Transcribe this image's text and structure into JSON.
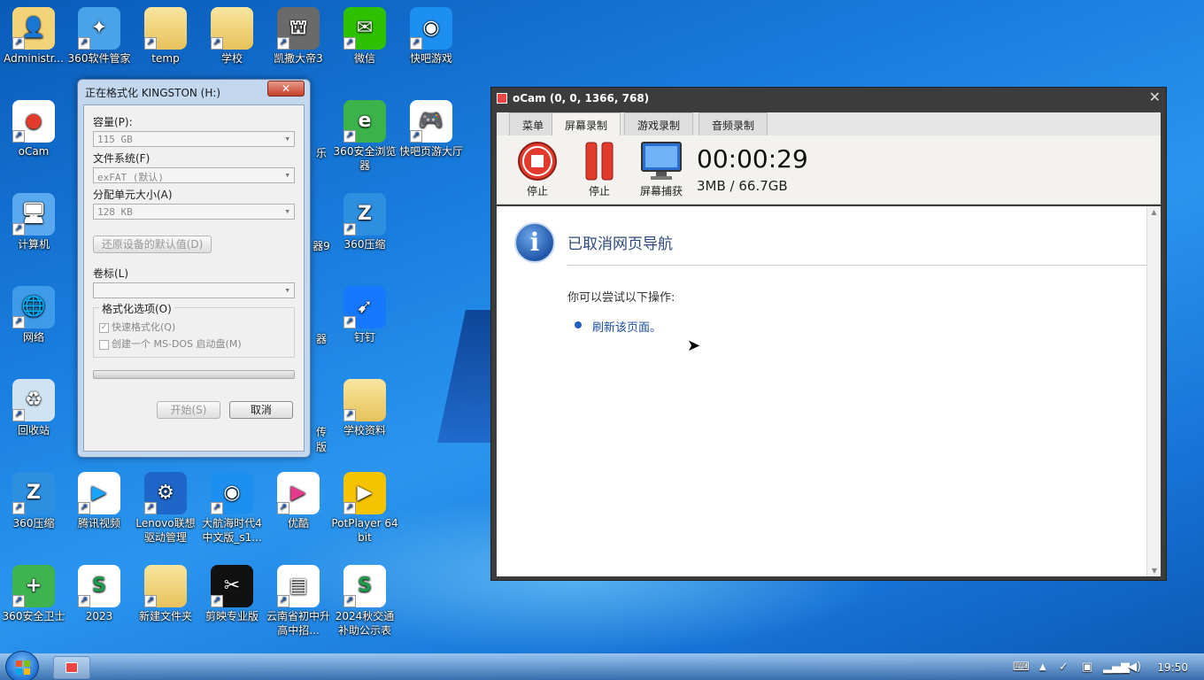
{
  "desktop": {
    "icons": [
      {
        "label": "Administr...",
        "kind": "user"
      },
      {
        "label": "360软件管家",
        "kind": "360box"
      },
      {
        "label": "temp",
        "kind": "folder"
      },
      {
        "label": "学校",
        "kind": "folder"
      },
      {
        "label": "凯撒大帝3",
        "kind": "game"
      },
      {
        "label": "微信",
        "kind": "wechat"
      },
      {
        "label": "快吧游戏",
        "kind": "kuaiba"
      },
      {
        "label": "oCam",
        "kind": "ocam"
      },
      {
        "label": "计算机",
        "kind": "computer"
      },
      {
        "label": "网络",
        "kind": "network"
      },
      {
        "label": "回收站",
        "kind": "recycle"
      },
      {
        "label": "360安全浏览器",
        "kind": "browser360"
      },
      {
        "label": "快吧页游大厅",
        "kind": "gamepad"
      },
      {
        "label": "360压缩",
        "kind": "zip360"
      },
      {
        "label": "钉钉",
        "kind": "dingtalk"
      },
      {
        "label": "学校资料",
        "kind": "folder"
      },
      {
        "label": "乐",
        "kind": "partial"
      },
      {
        "label": "器9",
        "kind": "partial"
      },
      {
        "label": "器",
        "kind": "partial"
      },
      {
        "label": "传",
        "kind": "partial"
      },
      {
        "label": "版",
        "kind": "partial"
      },
      {
        "label": "360压缩",
        "kind": "zip360"
      },
      {
        "label": "腾讯视频",
        "kind": "tencentvideo"
      },
      {
        "label": "Lenovo联想驱动管理",
        "kind": "lenovo"
      },
      {
        "label": "大航海时代4中文版_s1...",
        "kind": "kuaiba"
      },
      {
        "label": "优酷",
        "kind": "youku"
      },
      {
        "label": "PotPlayer 64 bit",
        "kind": "potplayer"
      },
      {
        "label": "360安全卫士",
        "kind": "guard360"
      },
      {
        "label": "2023",
        "kind": "sheet"
      },
      {
        "label": "新建文件夹",
        "kind": "folder"
      },
      {
        "label": "剪映专业版",
        "kind": "capcut"
      },
      {
        "label": "云南省初中升高中招...",
        "kind": "doc"
      },
      {
        "label": "2024秋交通补助公示表",
        "kind": "sheet"
      }
    ]
  },
  "format_dialog": {
    "title": "正在格式化 KINGSTON (H:)",
    "close_label": "✕",
    "capacity_label": "容量(P):",
    "capacity_value": "115 GB",
    "filesystem_label": "文件系统(F)",
    "filesystem_value": "exFAT (默认)",
    "alloc_label": "分配单元大小(A)",
    "alloc_value": "128 KB",
    "restore_label": "还原设备的默认值(D)",
    "volume_label": "卷标(L)",
    "volume_value": "",
    "options_title": "格式化选项(O)",
    "quick_format": "快速格式化(Q)",
    "msdos_disk": "创建一个 MS-DOS 启动盘(M)",
    "start_label": "开始(S)",
    "cancel_label": "取消"
  },
  "ocam": {
    "title": "oCam (0, 0, 1366, 768)",
    "close_label": "✕",
    "tabs": [
      "菜单",
      "屏幕录制",
      "游戏录制",
      "音频录制"
    ],
    "active_tab": "屏幕录制",
    "tools": {
      "stop1": "停止",
      "pause": "停止",
      "capture": "屏幕捕获"
    },
    "timer": "00:00:29",
    "size": "3MB / 66.7GB",
    "error_title": "已取消网页导航",
    "error_sub": "你可以尝试以下操作:",
    "error_link": "刷新该页面。"
  },
  "taskbar": {
    "clock": "19:50"
  },
  "colors": {
    "desktop_blue": "#1a7fe0",
    "ocam_frame": "#3c3c3c",
    "link_blue": "#1a4fa0",
    "record_red": "#e23b2e"
  }
}
